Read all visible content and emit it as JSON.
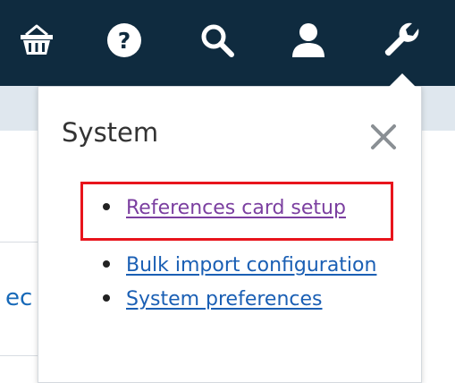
{
  "nav": {
    "icons": [
      {
        "name": "basket-icon"
      },
      {
        "name": "help-icon",
        "glyph": "?"
      },
      {
        "name": "search-icon"
      },
      {
        "name": "user-icon"
      },
      {
        "name": "wrench-icon"
      }
    ]
  },
  "background": {
    "fragment_text": "ec"
  },
  "panel": {
    "title": "System",
    "close_glyph": "×",
    "items": [
      {
        "label": "References card setup",
        "visited": true,
        "highlighted": true
      },
      {
        "label": "Bulk import configuration",
        "visited": false,
        "highlighted": false
      },
      {
        "label": "System preferences",
        "visited": false,
        "highlighted": false
      }
    ]
  },
  "colors": {
    "navbar": "#0f2b3f",
    "strip": "#dfe7ee",
    "visited_link": "#7b3fa0",
    "link": "#1a5fb4",
    "highlight": "#e8141c"
  }
}
